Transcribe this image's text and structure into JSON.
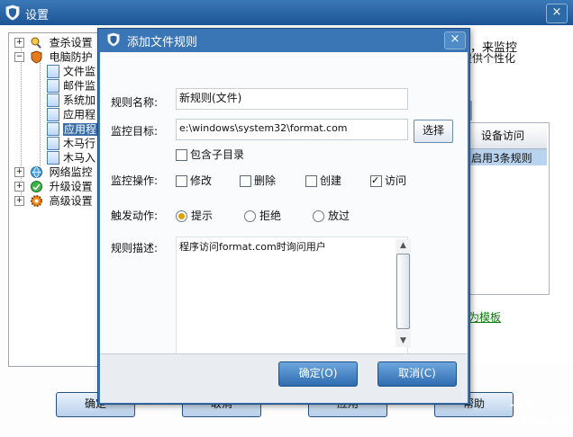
{
  "parent_window": {
    "title": "设置",
    "close_label": "×",
    "tree": [
      {
        "label": "查杀设置",
        "icon": "magnifier-person-icon",
        "expander": "+"
      },
      {
        "label": "电脑防护",
        "icon": "shield-orange-icon",
        "expander": "−"
      },
      {
        "label": "文件监",
        "icon": "document-icon"
      },
      {
        "label": "邮件监",
        "icon": "document-icon"
      },
      {
        "label": "系统加",
        "icon": "document-icon"
      },
      {
        "label": "应用程",
        "icon": "document-icon"
      },
      {
        "label": "应用程",
        "icon": "document-icon",
        "selected": true
      },
      {
        "label": "木马行",
        "icon": "document-icon"
      },
      {
        "label": "木马入",
        "icon": "document-icon"
      },
      {
        "label": "网络监控",
        "icon": "globe-icon",
        "expander": "+"
      },
      {
        "label": "升级设置",
        "icon": "globe-check-icon",
        "expander": "+"
      },
      {
        "label": "高级设置",
        "icon": "gear-icon",
        "expander": "+"
      }
    ],
    "right_panel": {
      "text_line1": "，来监控",
      "text_line2": "提供个性化",
      "table_header": "设备访问",
      "table_row": "启用3条规则",
      "save_template_link": "存为模板"
    },
    "buttons": {
      "ok": "确定",
      "cancel": "取消",
      "apply": "应用",
      "help": "帮助"
    },
    "watermark": {
      "brand": "卡卡",
      "url": "www.ikaka.com"
    }
  },
  "dialog": {
    "title": "添加文件规则",
    "close_label": "×",
    "rule_name_label": "规则名称:",
    "rule_name_value": "新规则(文件)",
    "target_label": "监控目标:",
    "target_value": "e:\\windows\\system32\\format.com",
    "select_button": "选择",
    "include_subdir_label": "包含子目录",
    "operation_label": "监控操作:",
    "operations": [
      {
        "label": "修改",
        "checked": false
      },
      {
        "label": "删除",
        "checked": false
      },
      {
        "label": "创建",
        "checked": false
      },
      {
        "label": "访问",
        "checked": true
      }
    ],
    "trigger_label": "触发动作:",
    "triggers": [
      {
        "label": "提示",
        "checked": true
      },
      {
        "label": "拒绝",
        "checked": false
      },
      {
        "label": "放过",
        "checked": false
      }
    ],
    "description_label": "规则描述:",
    "description_value": "程序访问format.com时询问用户",
    "ok_button": "确定(O)",
    "cancel_button": "取消(C)"
  }
}
